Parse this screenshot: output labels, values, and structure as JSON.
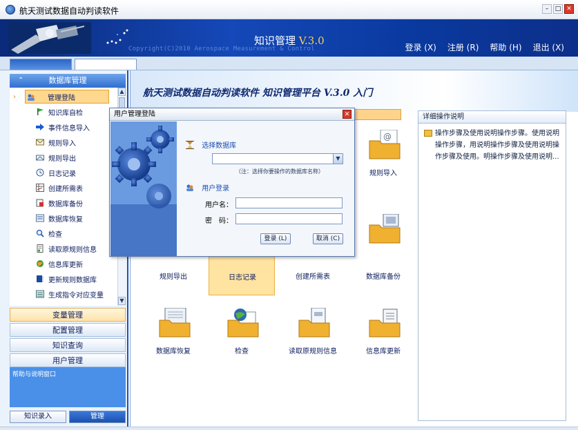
{
  "window": {
    "title": "航天测试数据自动判读软件",
    "controls": [
      "–",
      "□",
      "✕"
    ]
  },
  "banner": {
    "app_title": "知识管理",
    "version": "V.3.0",
    "copyright": "Copyright(C)2010 Aerospace Measurement & Control",
    "nav": [
      "登录 (X)",
      "注册 (R)",
      "帮助 (H)",
      "退出 (X)"
    ]
  },
  "sidebar": {
    "header": "数据库管理",
    "items": [
      {
        "label": "管理登陆",
        "icon": "users-icon"
      },
      {
        "label": "知识库自检",
        "icon": "flag-icon"
      },
      {
        "label": "事件信息导入",
        "icon": "arrow-right-icon"
      },
      {
        "label": "规则导入",
        "icon": "mail-icon"
      },
      {
        "label": "规则导出",
        "icon": "mail-out-icon"
      },
      {
        "label": "日志记录",
        "icon": "clock-icon"
      },
      {
        "label": "创建所需表",
        "icon": "table-icon"
      },
      {
        "label": "数据库备份",
        "icon": "backup-icon"
      },
      {
        "label": "数据库恢复",
        "icon": "restore-icon"
      },
      {
        "label": "检查",
        "icon": "magnifier-icon"
      },
      {
        "label": "读取原规则信息",
        "icon": "document-icon"
      },
      {
        "label": "信息库更新",
        "icon": "globe-icon"
      },
      {
        "label": "更新规则数据库",
        "icon": "book-icon"
      },
      {
        "label": "生成指令对应变量",
        "icon": "list-icon"
      }
    ],
    "sections": [
      "变量管理",
      "配置管理",
      "知识查询",
      "用户管理"
    ],
    "help_title": "帮助与说明窗口",
    "bottom_buttons": [
      "知识录入",
      "管理"
    ]
  },
  "main": {
    "heading": "航天测试数据自动判读软件  知识管理平台 V.3.0 入门",
    "tiles": [
      "规则导入",
      "规则导出",
      "日志记录",
      "创建所需表",
      "数据库备份",
      "数据库恢复",
      "检查",
      "读取原规则信息",
      "信息库更新"
    ],
    "detail_title": "详细操作说明",
    "detail_text": "操作步骤及使用说明操作步骤。使用说明操作步骤，用说明操作步骤及使用说明操作步骤及使用。明操作步骤及使用说明..."
  },
  "dialog": {
    "title": "用户管理登陆",
    "select_db_label": "选择数据库",
    "select_db_value": "",
    "note": "（注：选择你要操作的数据库名称）",
    "user_login_label": "用户登录",
    "username_label": "用户名：",
    "username_value": "",
    "password_label": "密　码：",
    "password_value": "",
    "login_button": "登录 (L)",
    "cancel_button": "取消 (C)"
  }
}
